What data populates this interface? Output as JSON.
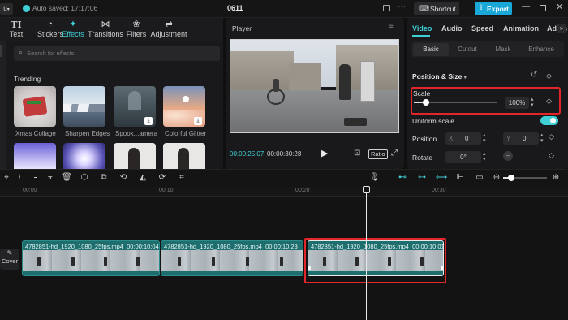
{
  "topbar": {
    "menu_label": "u",
    "autosave_text": "Auto saved: 17:17:06",
    "project_title": "0611",
    "shortcut_label": "Shortcut",
    "export_label": "Export"
  },
  "toolbar": {
    "items": [
      {
        "label": "Text",
        "icon": "text-icon"
      },
      {
        "label": "Stickers",
        "icon": "sticker-icon"
      },
      {
        "label": "Effects",
        "icon": "effects-icon"
      },
      {
        "label": "Transitions",
        "icon": "transitions-icon"
      },
      {
        "label": "Filters",
        "icon": "filters-icon"
      },
      {
        "label": "Adjustment",
        "icon": "adjustment-icon"
      }
    ],
    "active": "Effects",
    "text_glyph": "TI"
  },
  "effects": {
    "search_placeholder": "Search for effects",
    "section_title": "Trending",
    "items": [
      {
        "label": "Xmas Collage"
      },
      {
        "label": "Sharpen Edges"
      },
      {
        "label": "Spook...amera"
      },
      {
        "label": "Colorful Glitter"
      }
    ]
  },
  "player": {
    "title": "Player",
    "current_time": "00:00:25:07",
    "total_time": "00:00:30:28",
    "ratio_label": "Ratio"
  },
  "inspector": {
    "tabs": [
      "Video",
      "Audio",
      "Speed",
      "Animation",
      "Adjus"
    ],
    "active_tab": "Video",
    "subtabs": [
      "Basic",
      "Cutout",
      "Mask",
      "Enhance"
    ],
    "active_subtab": "Basic",
    "section_title": "Position & Size",
    "scale_label": "Scale",
    "scale_value": "100%",
    "scale_level": 0.15,
    "uniform_scale_label": "Uniform scale",
    "uniform_scale_on": true,
    "position_label": "Position",
    "x_label": "X",
    "x_value": "0",
    "y_label": "Y",
    "y_value": "0",
    "rotate_label": "Rotate",
    "rotate_value": "0°"
  },
  "timeline": {
    "ruler": [
      "00:00",
      "00:10",
      "00:20",
      "00:30"
    ],
    "cover_label": "Cover",
    "clips": [
      {
        "name": "4782851-hd_1920_1080_25fps.mp4",
        "duration": "00:00:10:04"
      },
      {
        "name": "4782851-hd_1920_1080_25fps.mp4",
        "duration": "00:00:10:23"
      },
      {
        "name": "4782851-hd_1920_1080_25fps.mp4",
        "duration": "00:00:10:01"
      }
    ]
  },
  "colors": {
    "accent": "#3fd0d6",
    "export": "#1aa8d8",
    "highlight": "#e2262a",
    "clip": "#1e6e6e"
  }
}
